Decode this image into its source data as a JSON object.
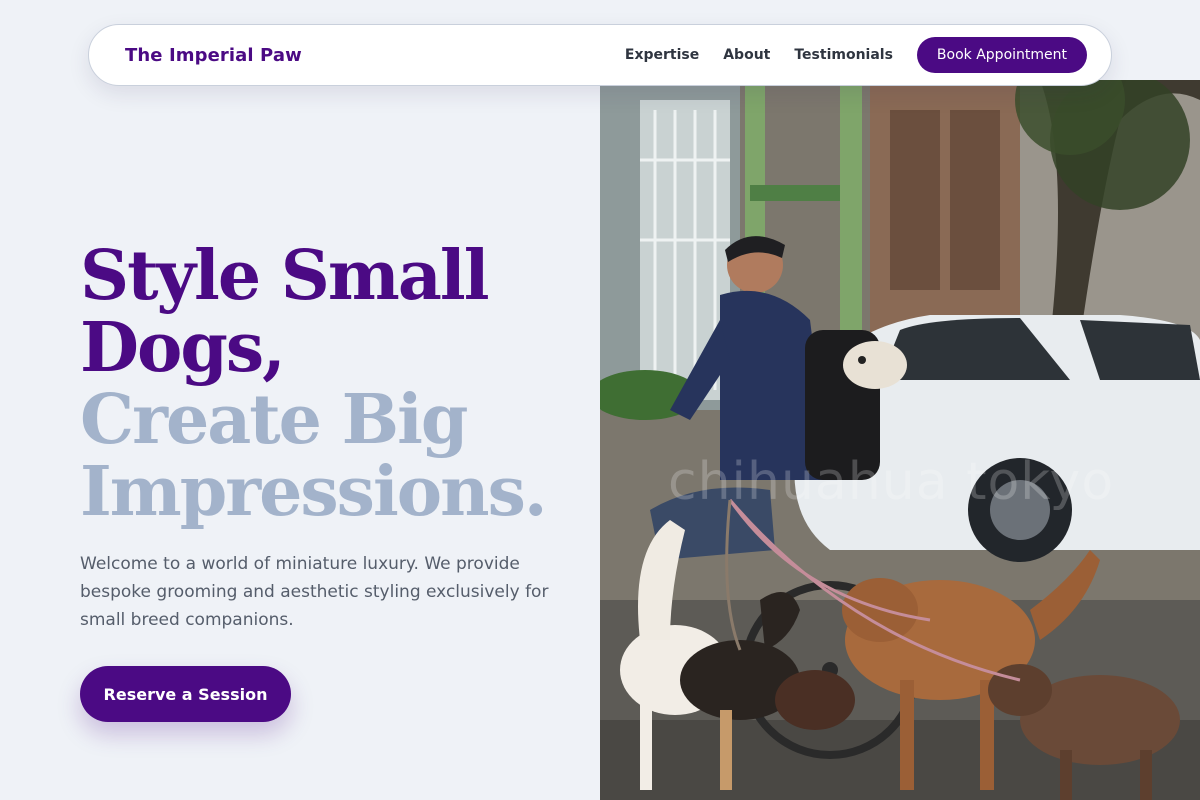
{
  "nav": {
    "brand": "The Imperial Paw",
    "links": [
      "Expertise",
      "About",
      "Testimonials"
    ],
    "cta_label": "Book Appointment"
  },
  "hero": {
    "headline_line1": "Style Small",
    "headline_line2": "Dogs,",
    "headline_line3": "Create Big",
    "headline_line4": "Impressions.",
    "intro": "Welcome to a world of miniature luxury. We provide bespoke grooming and aesthetic styling exclusively for small breed companions.",
    "cta_label": "Reserve a Session",
    "image": {
      "description": "",
      "watermark": "chihuahua tokyo"
    }
  },
  "colors": {
    "brand": "#4b0a84",
    "headline_muted": "#a3b3cb",
    "body_text": "#555d6b",
    "background": "#eff2f7"
  }
}
